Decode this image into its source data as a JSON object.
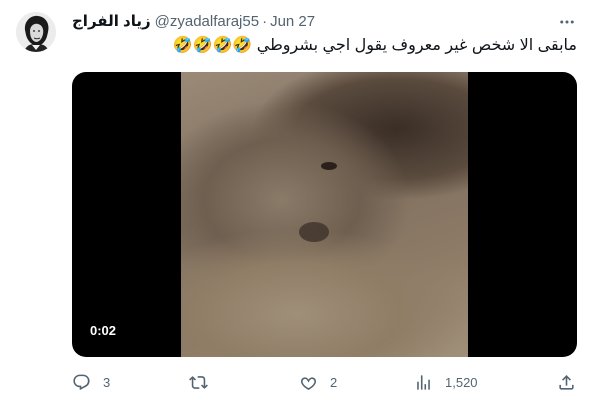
{
  "tweet": {
    "author": {
      "display_name": "زياد الفراج",
      "handle": "@zyadalfaraj55",
      "separator": "·",
      "time": "Jun 27",
      "avatar_icon": "beethoven-portrait-avatar"
    },
    "text": "مابقى الا شخص غير معروف يقول اجي بشروطي 🤣🤣🤣🤣",
    "media": {
      "type": "video",
      "duration": "0:02"
    },
    "actions": {
      "reply_count": "3",
      "retweet_count": "",
      "like_count": "2",
      "view_count": "1,520"
    }
  },
  "colors": {
    "text_primary": "#0f1419",
    "text_secondary": "#536471",
    "media_background": "#000000"
  }
}
